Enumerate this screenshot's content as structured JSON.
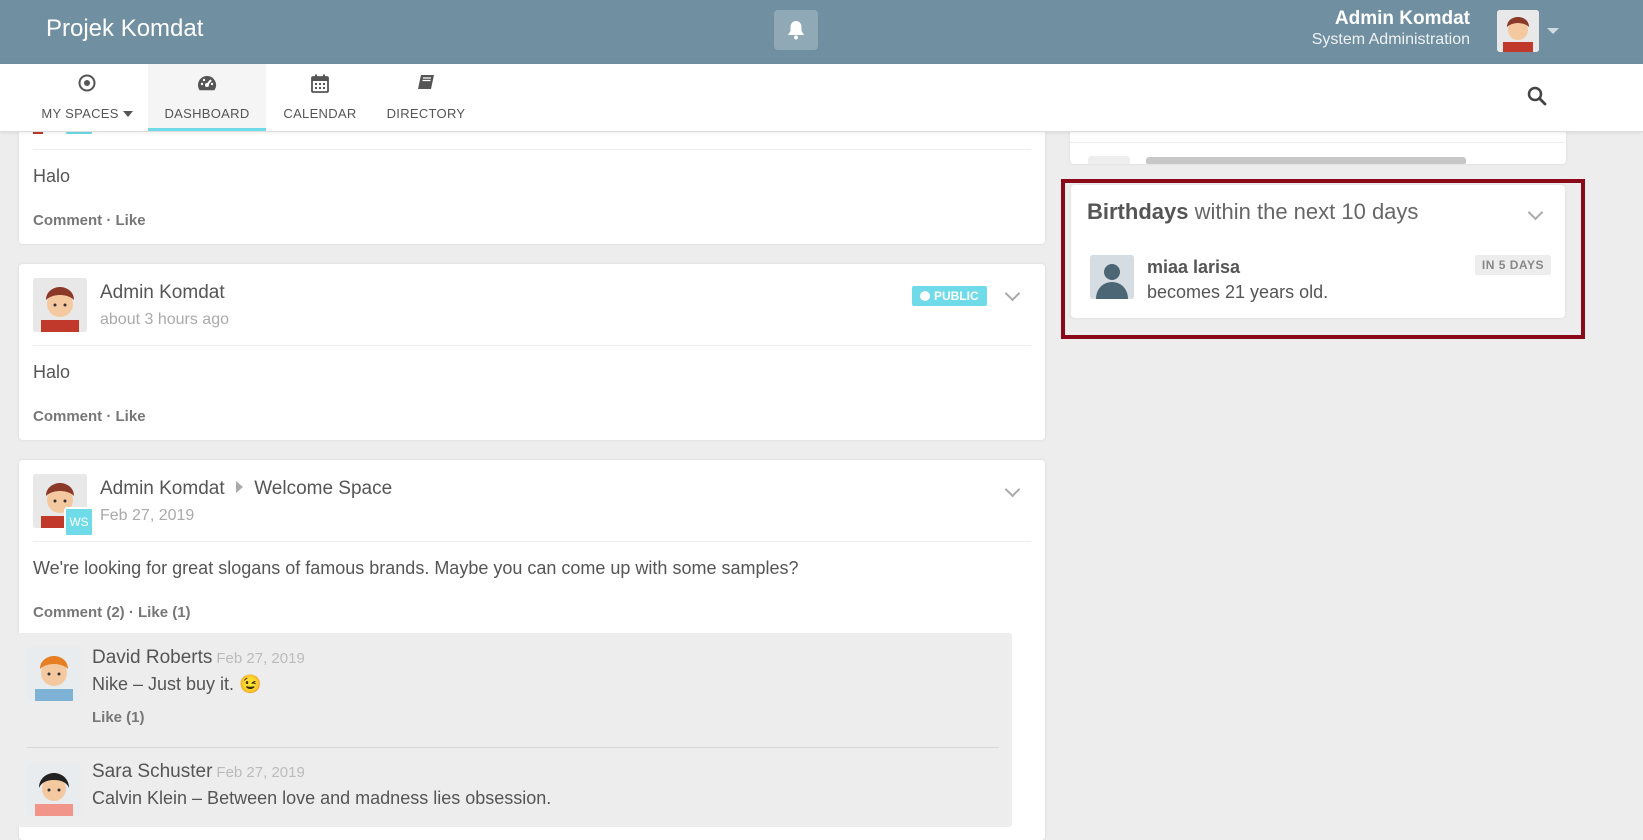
{
  "topbar": {
    "brand": "Projek Komdat",
    "user_name": "Admin Komdat",
    "user_role": "System Administration",
    "bell_icon": "bell-icon"
  },
  "nav": {
    "items": [
      {
        "label": "MY SPACES",
        "icon": "target-icon"
      },
      {
        "label": "DASHBOARD",
        "icon": "dashboard-icon"
      },
      {
        "label": "CALENDAR",
        "icon": "calendar-icon"
      },
      {
        "label": "DIRECTORY",
        "icon": "book-icon"
      }
    ],
    "search_icon": "search-icon"
  },
  "feed": {
    "post1": {
      "text": "Halo",
      "comment": "Comment",
      "like": "Like"
    },
    "post2": {
      "author": "Admin Komdat",
      "time": "about 3 hours ago",
      "badge": "PUBLIC",
      "text": "Halo",
      "comment": "Comment",
      "like": "Like"
    },
    "post3": {
      "author": "Admin Komdat",
      "space": "Welcome Space",
      "space_badge": "WS",
      "time": "Feb 27, 2019",
      "text": "We're looking for great slogans of famous brands. Maybe you can come up with some samples?",
      "comment": "Comment (2)",
      "like": "Like (1)",
      "comments": [
        {
          "name": "David Roberts",
          "date": "Feb 27, 2019",
          "text": "Nike – Just buy it. 😉",
          "like": "Like (1)"
        },
        {
          "name": "Sara Schuster",
          "date": "Feb 27, 2019",
          "text": "Calvin Klein – Between love and madness lies obsession."
        }
      ]
    }
  },
  "birthdays": {
    "title_bold": "Birthdays",
    "title_rest": "within the next 10 days",
    "name": "miaa larisa",
    "text": "becomes 21 years old.",
    "badge": "IN 5 DAYS"
  },
  "colors": {
    "topbar": "#708fa0",
    "accent": "#6fdbe8",
    "highlight": "#8b0a1a"
  }
}
